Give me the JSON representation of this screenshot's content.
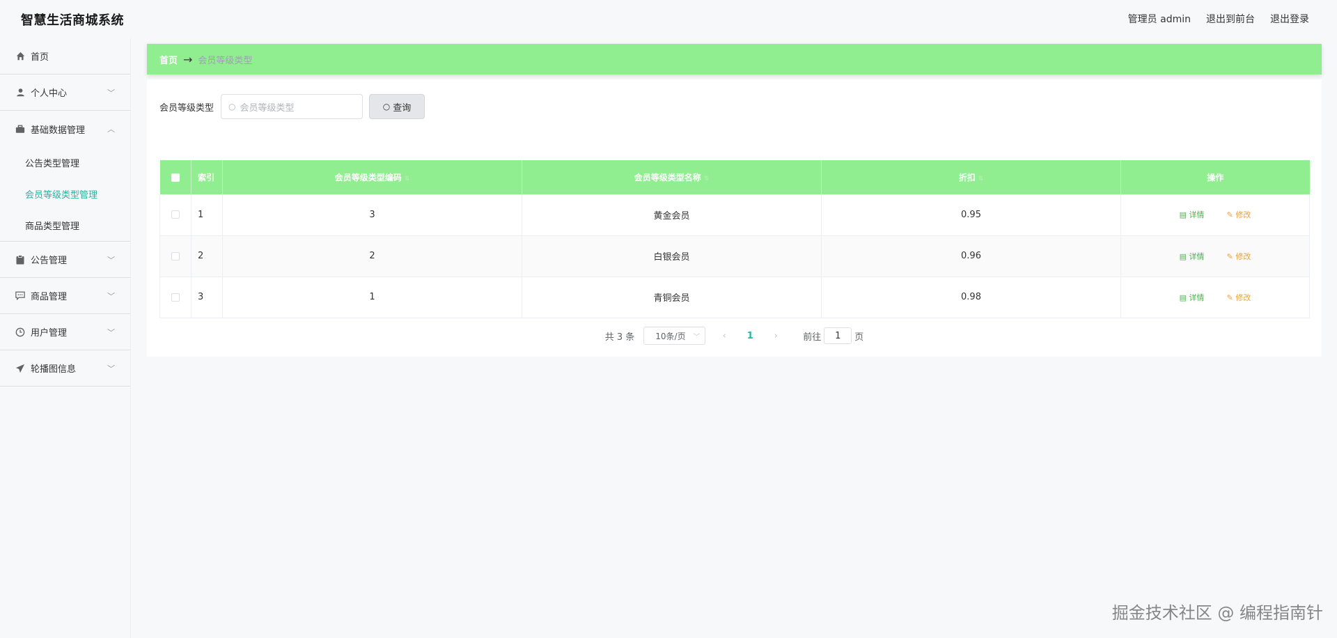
{
  "header": {
    "title": "智慧生活商城系统",
    "admin_label": "管理员 admin",
    "exit_front": "退出到前台",
    "logout": "退出登录"
  },
  "sidebar": {
    "items": [
      {
        "label": "首页",
        "icon": "home-icon"
      },
      {
        "label": "个人中心",
        "icon": "user-icon"
      },
      {
        "label": "基础数据管理",
        "icon": "briefcase-icon"
      },
      {
        "label": "公告管理",
        "icon": "clipboard-icon"
      },
      {
        "label": "商品管理",
        "icon": "chat-icon"
      },
      {
        "label": "用户管理",
        "icon": "clock-icon"
      },
      {
        "label": "轮播图信息",
        "icon": "send-icon"
      }
    ],
    "submenu": [
      {
        "label": "公告类型管理"
      },
      {
        "label": "会员等级类型管理"
      },
      {
        "label": "商品类型管理"
      }
    ]
  },
  "breadcrumb": {
    "home": "首页",
    "separator": "→",
    "current": "会员等级类型"
  },
  "search": {
    "label": "会员等级类型",
    "placeholder": "会员等级类型",
    "button": "查询"
  },
  "table": {
    "headers": [
      "索引",
      "会员等级类型编码",
      "会员等级类型名称",
      "折扣",
      "操作"
    ],
    "rows": [
      {
        "index": "1",
        "code": "3",
        "name": "黄金会员",
        "discount": "0.95"
      },
      {
        "index": "2",
        "code": "2",
        "name": "白银会员",
        "discount": "0.96"
      },
      {
        "index": "3",
        "code": "1",
        "name": "青铜会员",
        "discount": "0.98"
      }
    ],
    "action_detail": "详情",
    "action_edit": "修改"
  },
  "pagination": {
    "total": "共 3 条",
    "page_size": "10条/页",
    "current_page": "1",
    "goto_label": "前往",
    "goto_value": "1",
    "goto_unit": "页"
  },
  "watermark": "掘金技术社区 @ 编程指南针",
  "colors": {
    "accent_green": "#90ee90",
    "active_teal": "#29b3a2",
    "detail_green": "#4caf50",
    "edit_orange": "#e6a23c"
  }
}
